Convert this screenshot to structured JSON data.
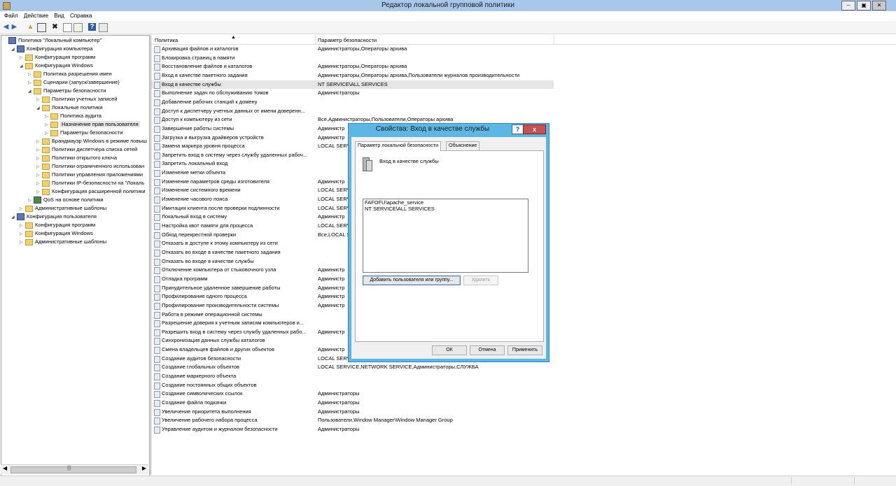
{
  "window": {
    "title": "Редактор локальной групповой политики"
  },
  "menu": [
    "Файл",
    "Действие",
    "Вид",
    "Справка"
  ],
  "toolbar_icons": [
    "back-icon",
    "forward-icon",
    "up-icon",
    "show-hide-tree-icon",
    "delete-icon",
    "properties-icon",
    "export-icon",
    "help-icon",
    "view-icon"
  ],
  "tree": [
    {
      "label": "Политика \"Локальный компьютер\"",
      "level": 0,
      "icon": "computer"
    },
    {
      "label": "Конфигурация компьютера",
      "level": 1,
      "icon": "computer",
      "expanded": true
    },
    {
      "label": "Конфигурация программ",
      "level": 2,
      "icon": "folder"
    },
    {
      "label": "Конфигурация Windows",
      "level": 2,
      "icon": "folder",
      "expanded": true
    },
    {
      "label": "Политика разрешения имен",
      "level": 3,
      "icon": "folder"
    },
    {
      "label": "Сценарии (запуск/завершение)",
      "level": 3,
      "icon": "folder"
    },
    {
      "label": "Параметры безопасности",
      "level": 3,
      "icon": "folder",
      "expanded": true
    },
    {
      "label": "Политики учетных записей",
      "level": 4,
      "icon": "folder"
    },
    {
      "label": "Локальные политики",
      "level": 4,
      "icon": "folder",
      "expanded": true
    },
    {
      "label": "Политика аудита",
      "level": 5,
      "icon": "folder"
    },
    {
      "label": "Назначение прав пользователя",
      "level": 5,
      "icon": "folder",
      "selected": true
    },
    {
      "label": "Параметры безопасности",
      "level": 5,
      "icon": "folder"
    },
    {
      "label": "Брандмауэр Windows в режиме повыш",
      "level": 4,
      "icon": "folder"
    },
    {
      "label": "Политики диспетчера списка сетей",
      "level": 4,
      "icon": "folder"
    },
    {
      "label": "Политики открытого ключа",
      "level": 4,
      "icon": "folder"
    },
    {
      "label": "Политики ограниченного использован",
      "level": 4,
      "icon": "folder"
    },
    {
      "label": "Политики управления приложениями",
      "level": 4,
      "icon": "folder"
    },
    {
      "label": "Политики IP-безопасности на \"Локаль",
      "level": 4,
      "icon": "folder"
    },
    {
      "label": "Конфигурация расширенной политики",
      "level": 4,
      "icon": "folder"
    },
    {
      "label": "QoS на основе политики",
      "level": 3,
      "icon": "chart"
    },
    {
      "label": "Административные шаблоны",
      "level": 2,
      "icon": "folder"
    },
    {
      "label": "Конфигурация пользователя",
      "level": 1,
      "icon": "computer",
      "expanded": true
    },
    {
      "label": "Конфигурация программ",
      "level": 2,
      "icon": "folder"
    },
    {
      "label": "Конфигурация Windows",
      "level": 2,
      "icon": "folder"
    },
    {
      "label": "Административные шаблоны",
      "level": 2,
      "icon": "folder"
    }
  ],
  "list": {
    "col1": "Политика",
    "col2": "Параметр безопасности",
    "rows": [
      {
        "name": "Архивация файлов и каталогов",
        "value": "Администраторы,Операторы архива"
      },
      {
        "name": "Блокировка страниц в памяти",
        "value": ""
      },
      {
        "name": "Восстановление файлов и каталогов",
        "value": "Администраторы,Операторы архива"
      },
      {
        "name": "Вход в качестве пакетного задания",
        "value": "Администраторы,Операторы архива,Пользователи журналов производительности"
      },
      {
        "name": "Вход в качестве службы",
        "value": "NT SERVICE\\ALL SERVICES",
        "selected": true
      },
      {
        "name": "Выполнение задач по обслуживанию томов",
        "value": "Администраторы"
      },
      {
        "name": "Добавление рабочих станций к домену",
        "value": ""
      },
      {
        "name": "Доступ к диспетчеру учетных данных от имени доверенн...",
        "value": ""
      },
      {
        "name": "Доступ к компьютеру из сети",
        "value": "Все,Администраторы,Пользователи,Операторы архива"
      },
      {
        "name": "Завершение работы системы",
        "value": "Администр"
      },
      {
        "name": "Загрузка и выгрузка драйверов устройств",
        "value": "Администр"
      },
      {
        "name": "Замена маркера уровня процесса",
        "value": "LOCAL SERV"
      },
      {
        "name": "Запретить вход в систему через службу удаленных рабоч...",
        "value": ""
      },
      {
        "name": "Запретить локальный вход",
        "value": ""
      },
      {
        "name": "Изменение метки объекта",
        "value": ""
      },
      {
        "name": "Изменение параметров среды изготовителя",
        "value": "Администр"
      },
      {
        "name": "Изменение системного времени",
        "value": "LOCAL SERV"
      },
      {
        "name": "Изменение часового пояса",
        "value": "LOCAL SERV"
      },
      {
        "name": "Имитация клиента после проверки подлинности",
        "value": "LOCAL SERV"
      },
      {
        "name": "Локальный вход в систему",
        "value": "Администр"
      },
      {
        "name": "Настройка квот памяти для процесса",
        "value": "LOCAL SERV"
      },
      {
        "name": "Обход перекрестной проверки",
        "value": "Все,LOCAL S"
      },
      {
        "name": "Отказать в доступе к этому компьютеру из сети",
        "value": ""
      },
      {
        "name": "Отказать во входе в качестве пакетного задания",
        "value": ""
      },
      {
        "name": "Отказать во входе в качестве службы",
        "value": ""
      },
      {
        "name": "Отключение компьютера от стыковочного узла",
        "value": "Администр"
      },
      {
        "name": "Отладка программ",
        "value": "Администр"
      },
      {
        "name": "Принудительное удаленное завершение работы",
        "value": "Администр"
      },
      {
        "name": "Профилирование одного процесса",
        "value": "Администр"
      },
      {
        "name": "Профилирование производительности системы",
        "value": "Администр"
      },
      {
        "name": "Работа в режиме операционной системы",
        "value": ""
      },
      {
        "name": "Разрешение доверия к учетным записям компьютеров и...",
        "value": ""
      },
      {
        "name": "Разрешить вход в систему через службу удаленных рабо...",
        "value": "Администр"
      },
      {
        "name": "Синхронизация данных службы каталогов",
        "value": ""
      },
      {
        "name": "Смена владельцев файлов и других объектов",
        "value": "Администр"
      },
      {
        "name": "Создание аудитов безопасности",
        "value": "LOCAL SERV"
      },
      {
        "name": "Создание глобальных объектов",
        "value": "LOCAL SERVICE,NETWORK SERVICE,Администраторы,СЛУЖБА"
      },
      {
        "name": "Создание маркерного объекта",
        "value": ""
      },
      {
        "name": "Создание постоянных общих объектов",
        "value": ""
      },
      {
        "name": "Создание символических ссылок",
        "value": "Администраторы"
      },
      {
        "name": "Создание файла подкачки",
        "value": "Администраторы"
      },
      {
        "name": "Увеличение приоритета выполнения",
        "value": "Администраторы"
      },
      {
        "name": "Увеличение рабочего набора процесса",
        "value": "Пользователи,Window Manager\\Window Manager Group"
      },
      {
        "name": "Управление аудитом и журналом безопасности",
        "value": "Администраторы"
      }
    ]
  },
  "dialog": {
    "title": "Свойства: Вход в качестве службы",
    "help_label": "?",
    "close_label": "x",
    "tab_local": "Параметр локальной безопасности",
    "tab_explain": "Объяснение",
    "policy_name": "Вход в качестве службы",
    "users": [
      "FAFOFU\\apache_service",
      "NT SERVICE\\ALL SERVICES"
    ],
    "add_button": "Добавить пользователя или группу...",
    "remove_button": "Удалить",
    "ok": "ОК",
    "cancel": "Отмена",
    "apply": "Применить"
  }
}
